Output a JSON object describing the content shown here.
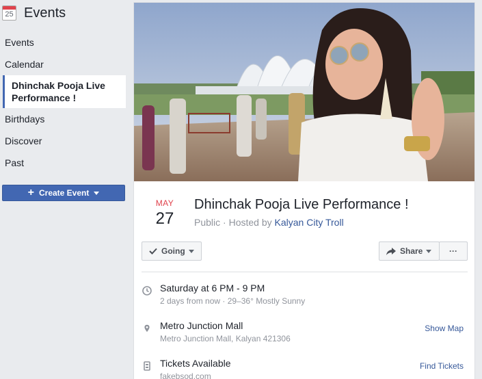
{
  "sidebar": {
    "icon_day": "25",
    "title": "Events",
    "items": [
      {
        "label": "Events"
      },
      {
        "label": "Calendar"
      },
      {
        "label": "Dhinchak Pooja Live Performance !"
      },
      {
        "label": "Birthdays"
      },
      {
        "label": "Discover"
      },
      {
        "label": "Past"
      }
    ],
    "create_label": "Create Event"
  },
  "event": {
    "month": "MAY",
    "day": "27",
    "title": "Dhinchak Pooja Live Performance !",
    "privacy": "Public",
    "hosted_by": "Hosted by",
    "host": "Kalyan City Troll"
  },
  "actions": {
    "going_label": "Going",
    "share_label": "Share",
    "more_label": "···"
  },
  "details": {
    "time": {
      "main": "Saturday at 6 PM - 9 PM",
      "sub": "2 days from now · 29–36° Mostly Sunny"
    },
    "location": {
      "main": "Metro Junction Mall",
      "sub": "Metro Junction Mall, Kalyan 421306",
      "link": "Show Map"
    },
    "tickets": {
      "main": "Tickets Available",
      "sub": "fakebsod.com",
      "link": "Find Tickets"
    }
  },
  "colors": {
    "accent": "#4267b2",
    "link": "#365899",
    "month_red": "#e0434d"
  },
  "icons": [
    "calendar-icon",
    "plus-icon",
    "check-icon",
    "share-arrow-icon",
    "clock-icon",
    "map-pin-icon",
    "ticket-icon"
  ]
}
